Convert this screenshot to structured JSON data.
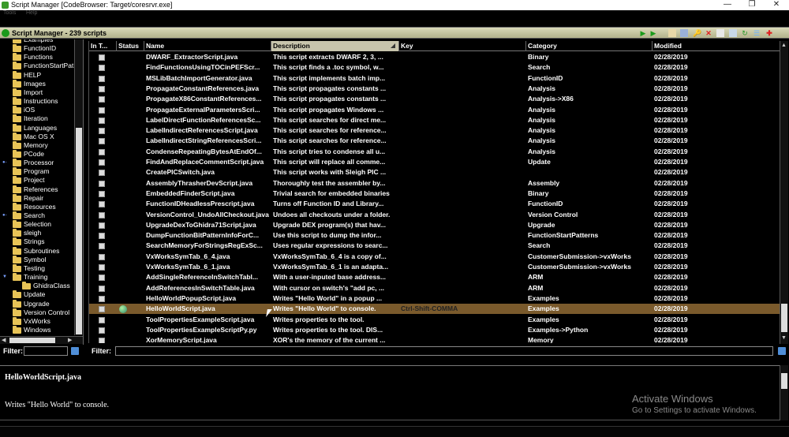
{
  "window": {
    "title": "Script Manager [CodeBrowser: Target/coresrvr.exe]",
    "minimize": "—",
    "restore": "❐",
    "close": "✕"
  },
  "menubar": {
    "tools": "Tools",
    "help": "Help"
  },
  "header": {
    "title": "Script Manager - 239 scripts"
  },
  "toolbar": {
    "run_icon": "play-icon",
    "run_again_icon": "play-again-icon",
    "colors": {
      "run": "#1b9a1b",
      "delete": "#e02020",
      "refresh": "#2a9a2a"
    }
  },
  "tree": {
    "items": [
      {
        "label": "Examples",
        "expand": ""
      },
      {
        "label": "FunctionID",
        "expand": ""
      },
      {
        "label": "Functions",
        "expand": ""
      },
      {
        "label": "FunctionStartPat",
        "expand": ""
      },
      {
        "label": "HELP",
        "expand": ""
      },
      {
        "label": "Images",
        "expand": ""
      },
      {
        "label": "Import",
        "expand": ""
      },
      {
        "label": "Instructions",
        "expand": ""
      },
      {
        "label": "iOS",
        "expand": ""
      },
      {
        "label": "Iteration",
        "expand": ""
      },
      {
        "label": "Languages",
        "expand": ""
      },
      {
        "label": "Mac OS X",
        "expand": ""
      },
      {
        "label": "Memory",
        "expand": ""
      },
      {
        "label": "PCode",
        "expand": ""
      },
      {
        "label": "Processor",
        "expand": "●-"
      },
      {
        "label": "Program",
        "expand": ""
      },
      {
        "label": "Project",
        "expand": ""
      },
      {
        "label": "References",
        "expand": ""
      },
      {
        "label": "Repair",
        "expand": ""
      },
      {
        "label": "Resources",
        "expand": ""
      },
      {
        "label": "Search",
        "expand": "●-"
      },
      {
        "label": "Selection",
        "expand": ""
      },
      {
        "label": "sleigh",
        "expand": ""
      },
      {
        "label": "Strings",
        "expand": ""
      },
      {
        "label": "Subroutines",
        "expand": ""
      },
      {
        "label": "Symbol",
        "expand": ""
      },
      {
        "label": "Testing",
        "expand": ""
      },
      {
        "label": "Training",
        "expand": "▼"
      },
      {
        "label": "GhidraClass",
        "expand": ""
      },
      {
        "label": "Update",
        "expand": ""
      },
      {
        "label": "Upgrade",
        "expand": ""
      },
      {
        "label": "Version Control",
        "expand": ""
      },
      {
        "label": "VxWorks",
        "expand": ""
      },
      {
        "label": "Windows",
        "expand": ""
      }
    ],
    "scroll_left": "◀",
    "scroll_right": "▶"
  },
  "filter": {
    "label": "Filter:"
  },
  "table": {
    "columns": [
      "In T...",
      "Status",
      "Name",
      "Description",
      "Key",
      "Category",
      "Modified"
    ],
    "rows": [
      {
        "name": "DWARF_ExtractorScript.java",
        "desc": "This script extracts DWARF 2, 3, ...",
        "key": "",
        "category": "Binary",
        "modified": "02/28/2019",
        "status": ""
      },
      {
        "name": "FindFunctionsUsingTOCinPEFScr...",
        "desc": "This script finds a .toc symbol, w...",
        "key": "",
        "category": "Search",
        "modified": "02/28/2019",
        "status": ""
      },
      {
        "name": "MSLibBatchImportGenerator.java",
        "desc": "This script implements batch imp...",
        "key": "",
        "category": "FunctionID",
        "modified": "02/28/2019",
        "status": ""
      },
      {
        "name": "PropagateConstantReferences.java",
        "desc": "This script propagates constants ...",
        "key": "",
        "category": "Analysis",
        "modified": "02/28/2019",
        "status": ""
      },
      {
        "name": "PropagateX86ConstantReferences...",
        "desc": "This script propagates constants ...",
        "key": "",
        "category": "Analysis->X86",
        "modified": "02/28/2019",
        "status": ""
      },
      {
        "name": "PropagateExternalParametersScri...",
        "desc": "This script propagates Windows ...",
        "key": "",
        "category": "Analysis",
        "modified": "02/28/2019",
        "status": ""
      },
      {
        "name": "LabelDirectFunctionReferencesSc...",
        "desc": "This script searches for direct me...",
        "key": "",
        "category": "Analysis",
        "modified": "02/28/2019",
        "status": ""
      },
      {
        "name": "LabelIndirectReferencesScript.java",
        "desc": "This script searches for reference...",
        "key": "",
        "category": "Analysis",
        "modified": "02/28/2019",
        "status": ""
      },
      {
        "name": "LabelIndirectStringReferencesScri...",
        "desc": "This script searches for reference...",
        "key": "",
        "category": "Analysis",
        "modified": "02/28/2019",
        "status": ""
      },
      {
        "name": "CondenseRepeatingBytesAtEndOf...",
        "desc": "This script tries to condense all u...",
        "key": "",
        "category": "Analysis",
        "modified": "02/28/2019",
        "status": ""
      },
      {
        "name": "FindAndReplaceCommentScript.java",
        "desc": "This script will replace all comme...",
        "key": "",
        "category": "Update",
        "modified": "02/28/2019",
        "status": ""
      },
      {
        "name": "CreatePICSwitch.java",
        "desc": "This script works with Sleigh PIC ...",
        "key": "",
        "category": "",
        "modified": "02/28/2019",
        "status": ""
      },
      {
        "name": "AssemblyThrasherDevScript.java",
        "desc": "Thoroughly test the assembler by...",
        "key": "",
        "category": "Assembly",
        "modified": "02/28/2019",
        "status": ""
      },
      {
        "name": "EmbeddedFinderScript.java",
        "desc": "Trivial search for embedded binaries",
        "key": "",
        "category": "Binary",
        "modified": "02/28/2019",
        "status": ""
      },
      {
        "name": "FunctionIDHeadlessPrescript.java",
        "desc": "Turns off Function ID and Library...",
        "key": "",
        "category": "FunctionID",
        "modified": "02/28/2019",
        "status": ""
      },
      {
        "name": "VersionControl_UndoAllCheckout.java",
        "desc": "Undoes all checkouts under a folder.",
        "key": "",
        "category": "Version Control",
        "modified": "02/28/2019",
        "status": ""
      },
      {
        "name": "UpgradeDexToGhidra71Script.java",
        "desc": "Upgrade DEX program(s) that hav...",
        "key": "",
        "category": "Upgrade",
        "modified": "02/28/2019",
        "status": ""
      },
      {
        "name": "DumpFunctionBitPatternInfoForC...",
        "desc": "Use this script to dump the infor...",
        "key": "",
        "category": "FunctionStartPatterns",
        "modified": "02/28/2019",
        "status": ""
      },
      {
        "name": "SearchMemoryForStringsRegExSc...",
        "desc": "Uses regular expressions to searc...",
        "key": "",
        "category": "Search",
        "modified": "02/28/2019",
        "status": ""
      },
      {
        "name": "VxWorksSymTab_6_4.java",
        "desc": "VxWorksSymTab_6_4 is a copy of...",
        "key": "",
        "category": "CustomerSubmission->vxWorks",
        "modified": "02/28/2019",
        "status": ""
      },
      {
        "name": "VxWorksSymTab_6_1.java",
        "desc": "VxWorksSymTab_6_1 is an adapta...",
        "key": "",
        "category": "CustomerSubmission->vxWorks",
        "modified": "02/28/2019",
        "status": ""
      },
      {
        "name": "AddSingleReferenceInSwitchTabl...",
        "desc": "With a user-inputed base address...",
        "key": "",
        "category": "ARM",
        "modified": "02/28/2019",
        "status": ""
      },
      {
        "name": "AddReferencesInSwitchTable.java",
        "desc": "With cursor on switch's \"add pc, ...",
        "key": "",
        "category": "ARM",
        "modified": "02/28/2019",
        "status": ""
      },
      {
        "name": "HelloWorldPopupScript.java",
        "desc": "Writes \"Hello World\" in a popup ...",
        "key": "",
        "category": "Examples",
        "modified": "02/28/2019",
        "status": ""
      },
      {
        "name": "HelloWorldScript.java",
        "desc": "Writes \"Hello World\" to console.",
        "key": "Ctrl-Shift-COMMA",
        "category": "Examples",
        "modified": "02/28/2019",
        "status": "running-globe-icon",
        "selected": true
      },
      {
        "name": "ToolPropertiesExampleScript.java",
        "desc": "Writes properties to the tool.",
        "key": "",
        "category": "Examples",
        "modified": "02/28/2019",
        "status": ""
      },
      {
        "name": "ToolPropertiesExampleScriptPy.py",
        "desc": "Writes properties to the tool. DIS...",
        "key": "",
        "category": "Examples->Python",
        "modified": "02/28/2019",
        "status": ""
      },
      {
        "name": "XorMemoryScript.java",
        "desc": "XOR's the memory of the current ...",
        "key": "",
        "category": "Memory",
        "modified": "02/28/2019",
        "status": ""
      }
    ]
  },
  "description": {
    "name": "HelloWorldScript.java",
    "text": "Writes \"Hello World\" to console."
  },
  "watermark": {
    "line1": "Activate Windows",
    "line2": "Go to Settings to activate Windows."
  }
}
